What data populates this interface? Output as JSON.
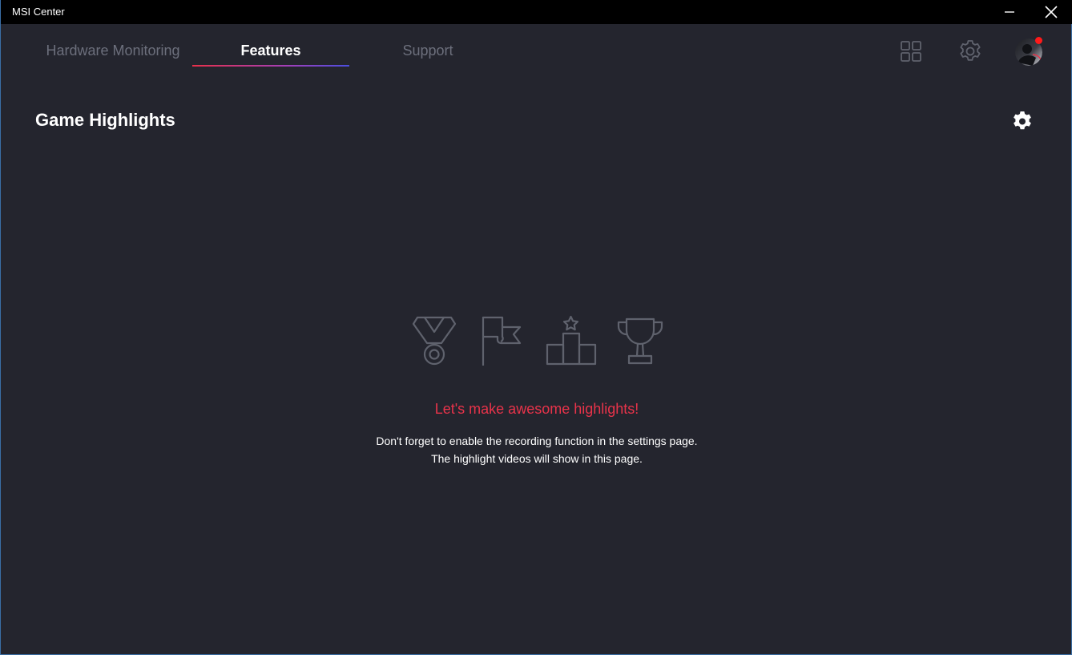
{
  "window": {
    "title": "MSI Center"
  },
  "tabs": [
    {
      "label": "Hardware Monitoring",
      "active": false
    },
    {
      "label": "Features",
      "active": true
    },
    {
      "label": "Support",
      "active": false
    }
  ],
  "header_icons": [
    "apps-grid-icon",
    "settings-gear-icon",
    "user-avatar"
  ],
  "page": {
    "title": "Game Highlights",
    "settings_icon": "gear-icon"
  },
  "empty_state": {
    "icons": [
      "medal-icon",
      "flag-icon",
      "podium-icon",
      "trophy-icon"
    ],
    "headline": "Let's make awesome highlights!",
    "line1": "Don't forget to enable the recording function in the settings page.",
    "line2": "The highlight videos will show in this page."
  },
  "colors": {
    "background": "#24252e",
    "titlebar": "#000000",
    "accent_red": "#e8334a",
    "inactive_tab": "#6c6f7c",
    "icon_gray": "#5f626d"
  }
}
